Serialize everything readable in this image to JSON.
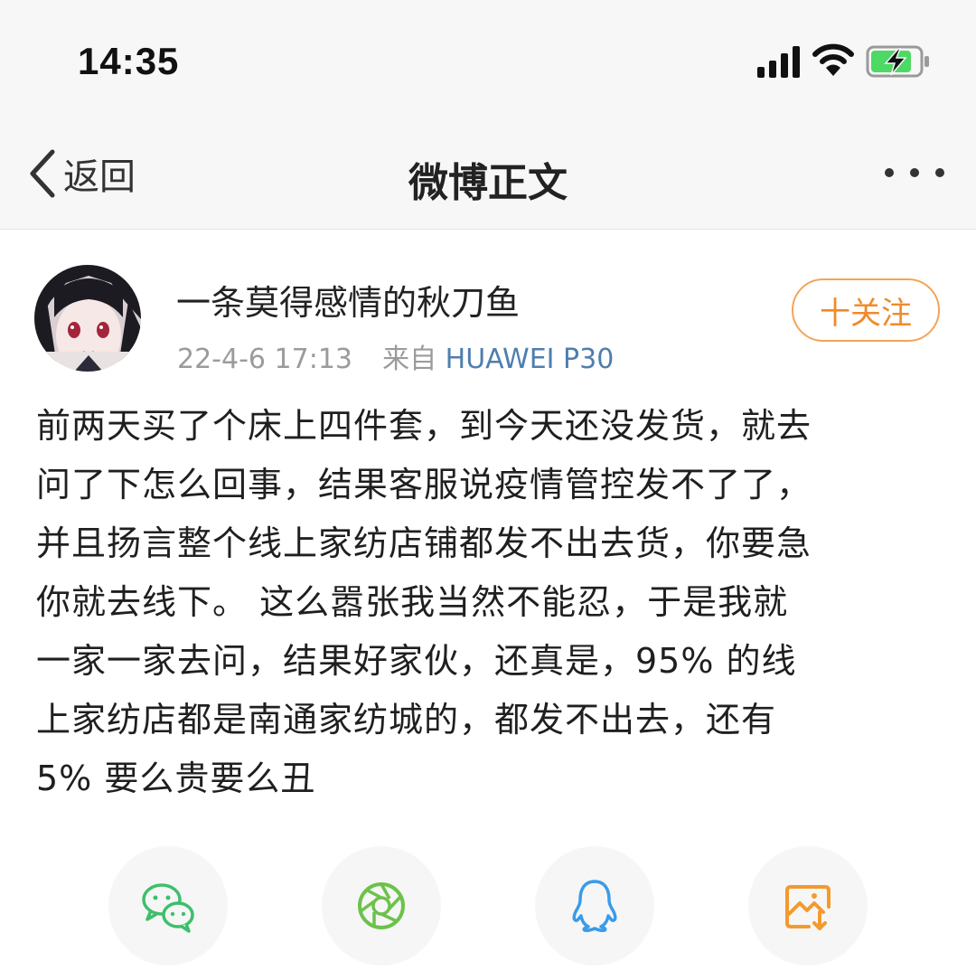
{
  "status_bar": {
    "time": "14:35"
  },
  "nav": {
    "back_label": "返回",
    "title": "微博正文"
  },
  "post": {
    "username": "一条莫得感情的秋刀鱼",
    "timestamp": "22-4-6 17:13",
    "source_prefix": "来自",
    "device": "HUAWEI P30",
    "follow_label": "十关注",
    "lines": [
      "前两天买了个床上四件套，到今天还没发货，就去",
      "问了下怎么回事，结果客服说疫情管控发不了了，",
      "并且扬言整个线上家纺店铺都发不出去货，你要急",
      "你就去线下。 这么嚣张我当然不能忍，于是我就",
      "一家一家去问，结果好家伙，还真是，95% 的线",
      "上家纺店都是南通家纺城的，都发不出去，还有",
      "5% 要么贵要么丑"
    ]
  },
  "share": [
    {
      "name": "wechat",
      "icon": "wechat-icon",
      "color": "#3dbf6c"
    },
    {
      "name": "moments",
      "icon": "camera-shutter-icon",
      "color": "#6cc24a"
    },
    {
      "name": "qq",
      "icon": "qq-penguin-icon",
      "color": "#3a9be8"
    },
    {
      "name": "save-image",
      "icon": "save-image-icon",
      "color": "#f39a2c"
    }
  ],
  "colors": {
    "accent": "#f08a2a",
    "device_link": "#4f7eaf",
    "meta_gray": "#9b9b9b"
  }
}
